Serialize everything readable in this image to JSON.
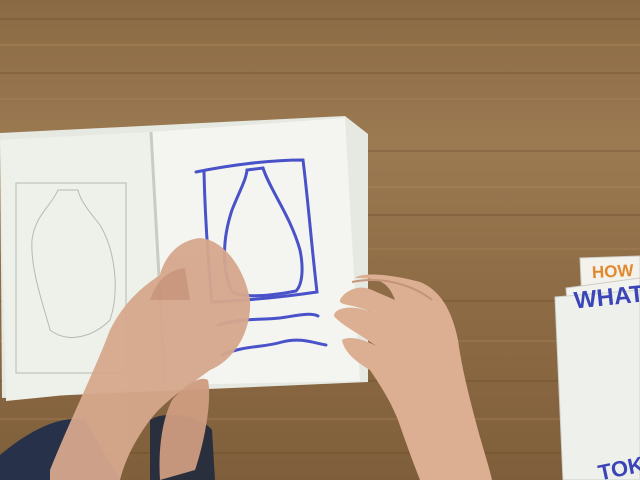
{
  "scene": {
    "description_colors": {
      "table_wood": "#8f6d46",
      "paper": "#f2f3ee",
      "marker_blue": "#4a52c9",
      "skin": "#d9a889",
      "sleeve": "#27324a"
    }
  },
  "cards": {
    "card_top_text": "HOW",
    "card_middle_text": "WHAT",
    "card_bottom_text": "TOK"
  }
}
